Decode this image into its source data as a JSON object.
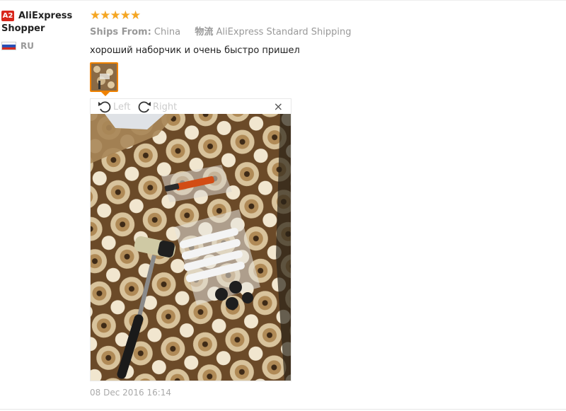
{
  "user": {
    "badge": "A2",
    "name": "AliExpress Shopper",
    "country": "RU"
  },
  "review": {
    "rating": 5,
    "stars": "★★★★★",
    "ships_from_label": "Ships From:",
    "ships_from_value": "China",
    "logistics_label": "物流",
    "logistics_value": "AliExpress Standard Shipping",
    "text": "хороший наборчик и очень быстро пришел",
    "date": "08 Dec 2016 16:14"
  },
  "viewer": {
    "rotate_left_label": "Left",
    "rotate_right_label": "Right",
    "close_symbol": "×"
  },
  "colors": {
    "star": "#f5a623",
    "badge": "#d8261b",
    "thumb_border": "#f08200"
  }
}
